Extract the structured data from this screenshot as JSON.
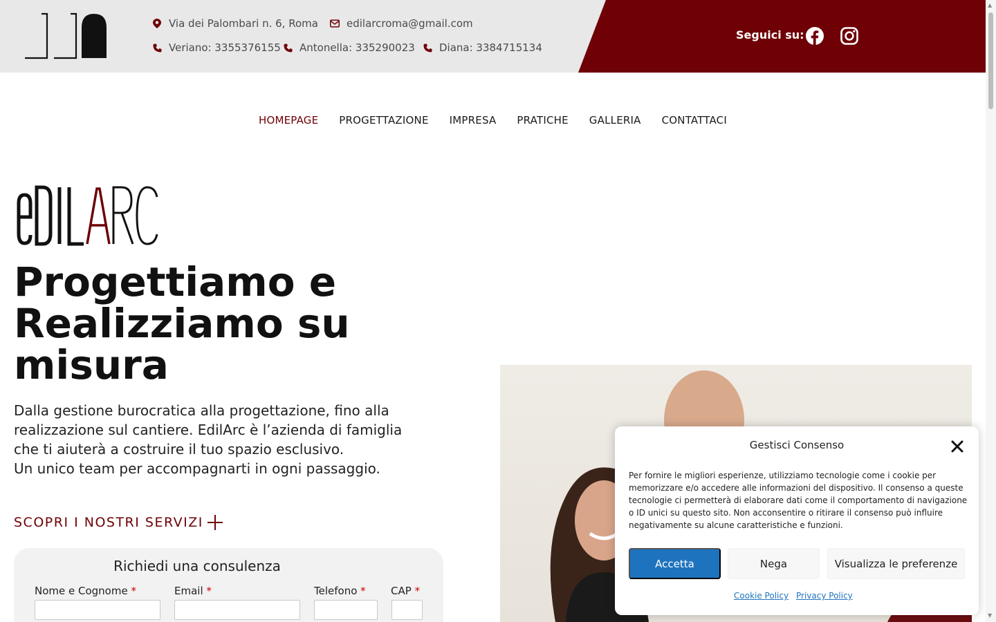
{
  "topbar": {
    "address": "Via dei Palombari n. 6, Roma",
    "email": "edilarcroma@gmail.com",
    "phones": [
      "Veriano: 3355376155",
      "Antonella: 335290023",
      "Diana: 3384715134"
    ],
    "social_label": "Seguici su:",
    "icons": {
      "address": "map-pin-icon",
      "email": "envelope-icon",
      "phone": "phone-icon",
      "facebook": "facebook-icon",
      "instagram": "instagram-icon"
    },
    "colors": {
      "bar": "#e8e8e8",
      "accent": "#6e0006"
    }
  },
  "nav": {
    "items": [
      "HOMEPAGE",
      "PROGETTAZIONE",
      "IMPRESA",
      "PRATICHE",
      "GALLERIA",
      "CONTATTACI"
    ],
    "active": "HOMEPAGE"
  },
  "hero": {
    "brand_name": "EDILARC",
    "title": "Progettiamo e Realizziamo su misura",
    "lead_lines": [
      "Dalla gestione burocratica alla progettazione, fino alla",
      "realizzazione sul cantiere. EdilArc è l’azienda di famiglia",
      "che ti aiuterà a costruire il tuo spazio esclusivo.",
      "Un unico team per accompagnarti in ogni passaggio."
    ],
    "cta": "SCOPRI I NOSTRI SERVIZI"
  },
  "form": {
    "title": "Richiedi una consulenza",
    "fields": [
      {
        "label": "Nome e Cognome",
        "value": "",
        "required": "*"
      },
      {
        "label": "Email",
        "value": "",
        "required": "*"
      },
      {
        "label": "Telefono",
        "value": "",
        "required": "*"
      },
      {
        "label": "CAP",
        "value": "",
        "required": "*"
      }
    ]
  },
  "cookie": {
    "title": "Gestisci Consenso",
    "text": "Per fornire le migliori esperienze, utilizziamo tecnologie come i cookie per memorizzare e/o accedere alle informazioni del dispositivo. Il consenso a queste tecnologie ci permetterà di elaborare dati come il comportamento di navigazione o ID unici su questo sito. Non acconsentire o ritirare il consenso può influire negativamente su alcune caratteristiche e funzioni.",
    "accept": "Accetta",
    "deny": "Nega",
    "prefs": "Visualizza le preferenze",
    "cookie_policy": "Cookie Policy",
    "privacy_policy": "Privacy Policy",
    "close_icon": "close-icon",
    "colors": {
      "primary": "#1e73be"
    }
  }
}
